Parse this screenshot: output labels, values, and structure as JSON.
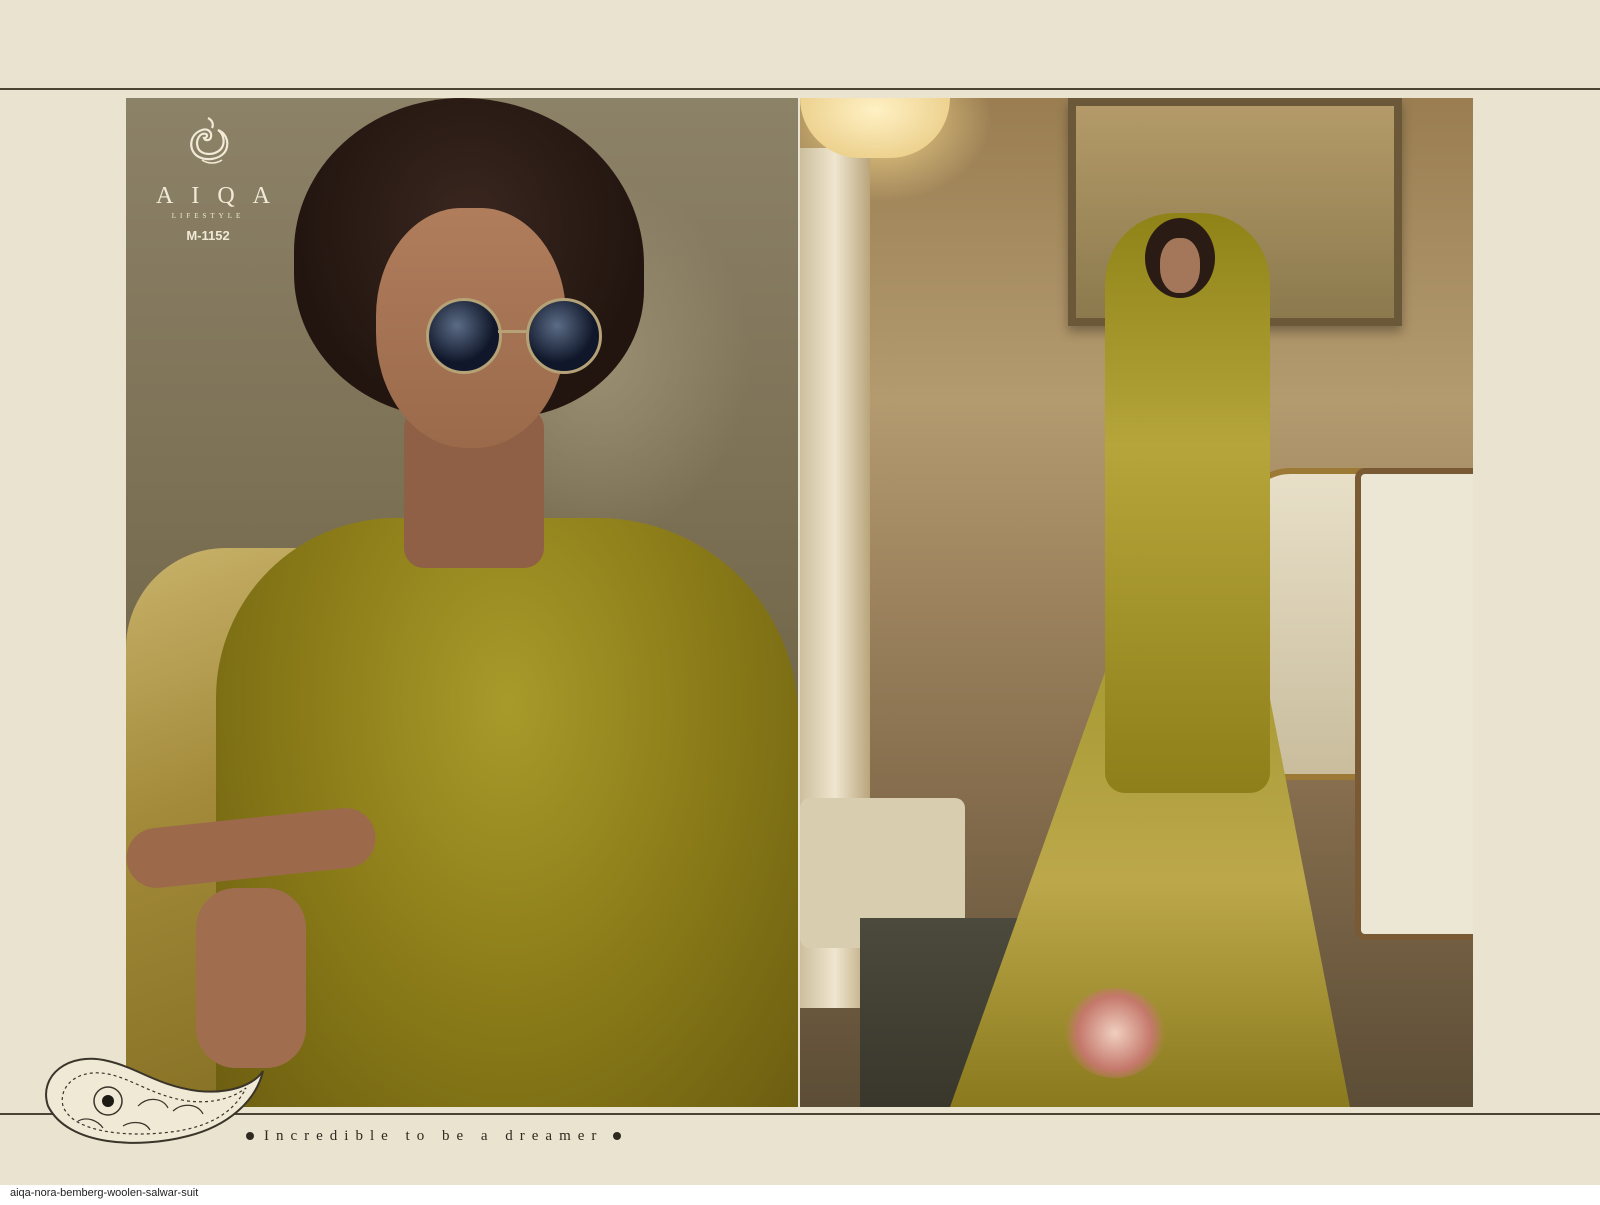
{
  "brand": {
    "name": "AIQA",
    "tagline_small": "LIFESTYLE",
    "design_code": "M-1152"
  },
  "catalog": {
    "tagline": "Incredible to be a dreamer"
  },
  "footer": {
    "label": "aiqa-nora-bemberg-woolen-salwar-suit"
  },
  "colors": {
    "background": "#e9e3cf",
    "garment": "#8a7b18",
    "rule": "#4a4434"
  },
  "icons": [
    "swan-logo-icon",
    "paisley-icon",
    "bullet-dot-icon"
  ]
}
